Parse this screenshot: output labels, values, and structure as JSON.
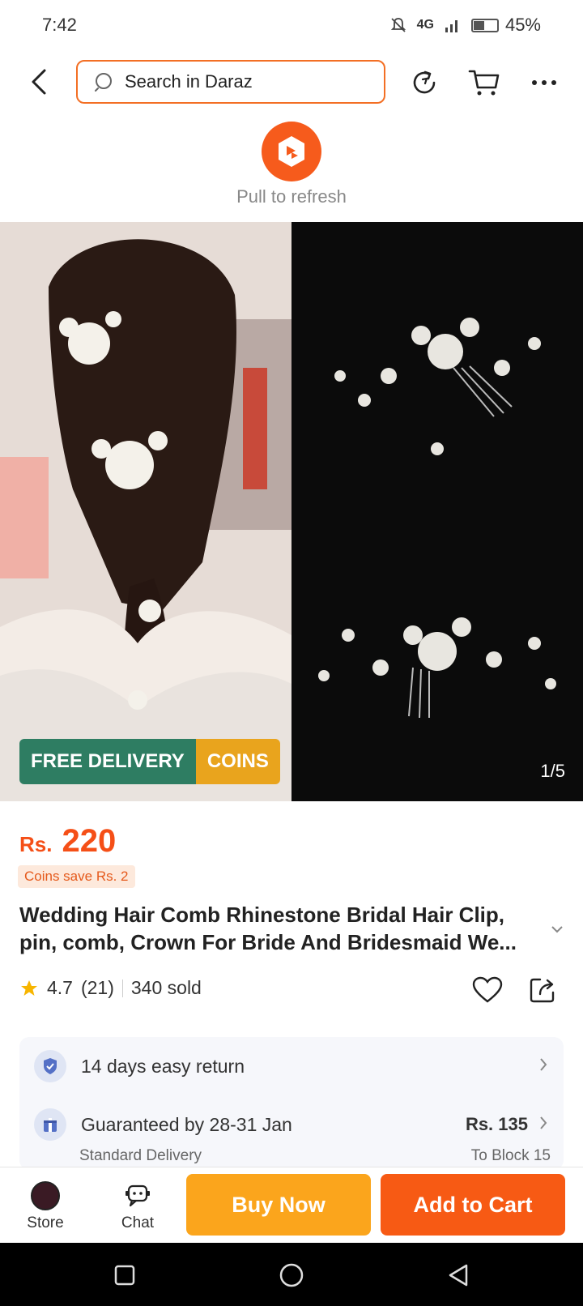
{
  "status_bar": {
    "time": "7:42",
    "network": "4G",
    "battery": "45%",
    "battery_level": 0.45
  },
  "top_nav": {
    "search_placeholder": "Search in Daraz"
  },
  "refresh": {
    "text": "Pull to refresh"
  },
  "gallery": {
    "badge_delivery": "FREE DELIVERY",
    "badge_coins": "COINS",
    "counter": "1/5"
  },
  "product": {
    "currency": "Rs.",
    "price": "220",
    "coins_save": "Coins save Rs. 2",
    "title": "Wedding Hair Comb Rhinestone Bridal Hair Clip, pin, comb, Crown For Bride And Bridesmaid We...",
    "rating": "4.7",
    "reviews": "(21)",
    "sold": "340 sold",
    "rating_value": 4.7
  },
  "services": {
    "return_text": "14 days easy return",
    "delivery_text": "Guaranteed by 28-31 Jan",
    "delivery_price": "Rs. 135",
    "delivery_type": "Standard Delivery",
    "delivery_location": "To Block 15"
  },
  "action_bar": {
    "store": "Store",
    "chat": "Chat",
    "buy_now": "Buy Now",
    "add_to_cart": "Add to Cart"
  },
  "colors": {
    "accent": "#f36f24",
    "buy": "#fba51c",
    "cart": "#f75a14",
    "delivery_badge": "#2e7d62",
    "coins_badge": "#e9a41d"
  }
}
